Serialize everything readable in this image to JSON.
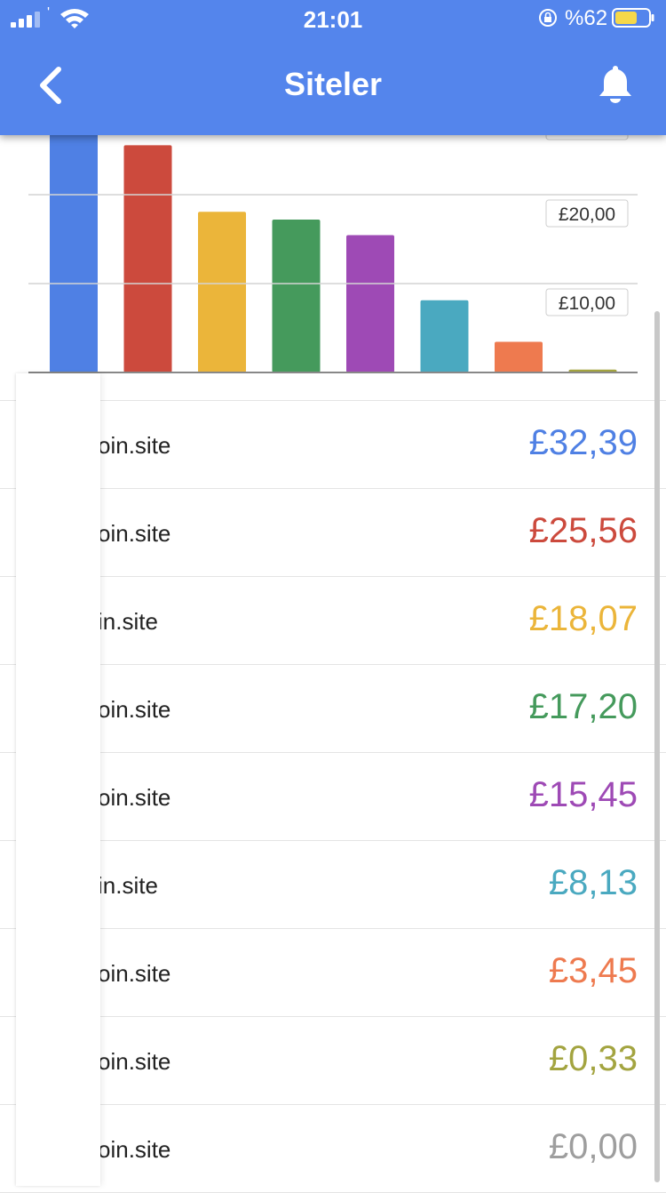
{
  "status_bar": {
    "time": "21:01",
    "carrier": "'",
    "battery_percent": "%62",
    "icons": [
      "signal-icon",
      "wifi-icon",
      "orientation-lock-icon",
      "battery-icon"
    ]
  },
  "header": {
    "title": "Siteler",
    "back_icon": "chevron-left-icon",
    "bell_icon": "bell-icon"
  },
  "colors": {
    "header_bg": "#5485ec",
    "blue": "#4f80e4",
    "red": "#cc4a3d",
    "yellow": "#ebb53a",
    "green": "#459a5c",
    "purple": "#9e4ab5",
    "teal": "#4aa9c0",
    "orange": "#ee7a4f",
    "olive": "#a3a440",
    "gray": "#9e9e9e"
  },
  "chart_data": {
    "type": "bar",
    "values": [
      32.39,
      25.56,
      18.07,
      17.2,
      15.45,
      8.13,
      3.45,
      0.33,
      0.0
    ],
    "colors": [
      "#4f80e4",
      "#cc4a3d",
      "#ebb53a",
      "#459a5c",
      "#9e4ab5",
      "#4aa9c0",
      "#ee7a4f",
      "#a3a440",
      "#9e9e9e"
    ],
    "y_tick_labels": [
      "£10,00",
      "£20,00"
    ],
    "y_ticks": [
      10,
      20
    ],
    "grid": true
  },
  "sites": [
    {
      "name": "oin.site",
      "amount": "£32,39",
      "color": "#4f80e4"
    },
    {
      "name": "oin.site",
      "amount": "£25,56",
      "color": "#cc4a3d"
    },
    {
      "name": "in.site",
      "amount": "£18,07",
      "color": "#ebb53a"
    },
    {
      "name": "oin.site",
      "amount": "£17,20",
      "color": "#459a5c"
    },
    {
      "name": "oin.site",
      "amount": "£15,45",
      "color": "#9e4ab5"
    },
    {
      "name": "in.site",
      "amount": "£8,13",
      "color": "#4aa9c0"
    },
    {
      "name": "oin.site",
      "amount": "£3,45",
      "color": "#ee7a4f"
    },
    {
      "name": "oin.site",
      "amount": "£0,33",
      "color": "#a3a440"
    },
    {
      "name": "oin.site",
      "amount": "£0,00",
      "color": "#9e9e9e"
    }
  ]
}
